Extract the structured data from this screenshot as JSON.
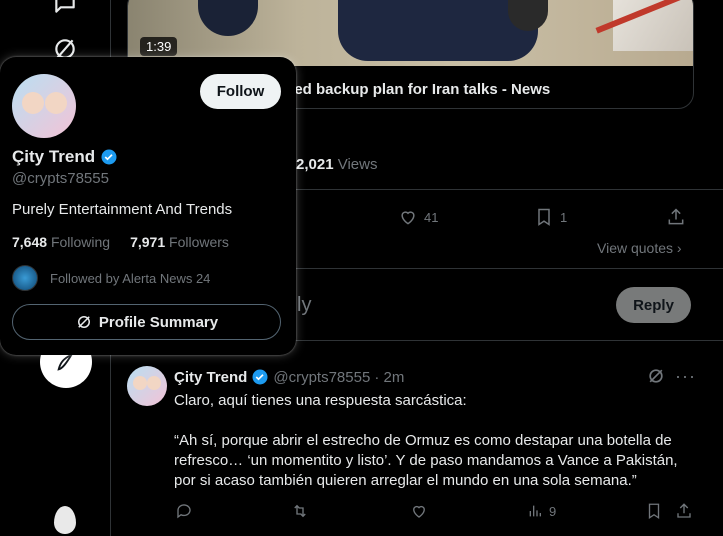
{
  "media": {
    "duration": "1:39",
    "title_visible": "eed backup plan for Iran talks - News"
  },
  "post_stats": {
    "views_count": "2,021",
    "views_label": "Views",
    "likes": "41",
    "bookmarks": "1",
    "view_quotes": "View quotes"
  },
  "reply_box": {
    "placeholder_visible": "ly",
    "reply_button": "Reply"
  },
  "reply_tweet": {
    "name": "Çity Trend",
    "handle": "@crypts78555",
    "time": "· 2m",
    "line1": "Claro, aquí tienes una respuesta sarcástica:",
    "line2": "“Ah sí, porque abrir el estrecho de Ormuz es como destapar una botella de refresco… ‘un momentito y listo’. Y de paso mandamos a Vance a Pakistán, por si acaso también quieren arreglar el mundo en una sola semana.”",
    "views": "9"
  },
  "hover_card": {
    "follow_button": "Follow",
    "name": "Çity Trend",
    "handle": "@crypts78555",
    "bio": "Purely Entertainment And Trends",
    "following_count": "7,648",
    "following_label": "Following",
    "followers_count": "7,971",
    "followers_label": "Followers",
    "followed_by": "Followed by Alerta News 24",
    "profile_summary_button": "Profile Summary"
  },
  "colors": {
    "verified": "#1d9bf0",
    "muted_text": "#71767b",
    "border": "#2f3336"
  },
  "icons": [
    "messages-icon",
    "grok-icon",
    "compose-icon",
    "like-icon",
    "bookmark-icon",
    "share-icon",
    "reply-icon",
    "retweet-icon",
    "analytics-icon",
    "more-icon",
    "chevron-right-icon",
    "verified-badge-icon"
  ]
}
